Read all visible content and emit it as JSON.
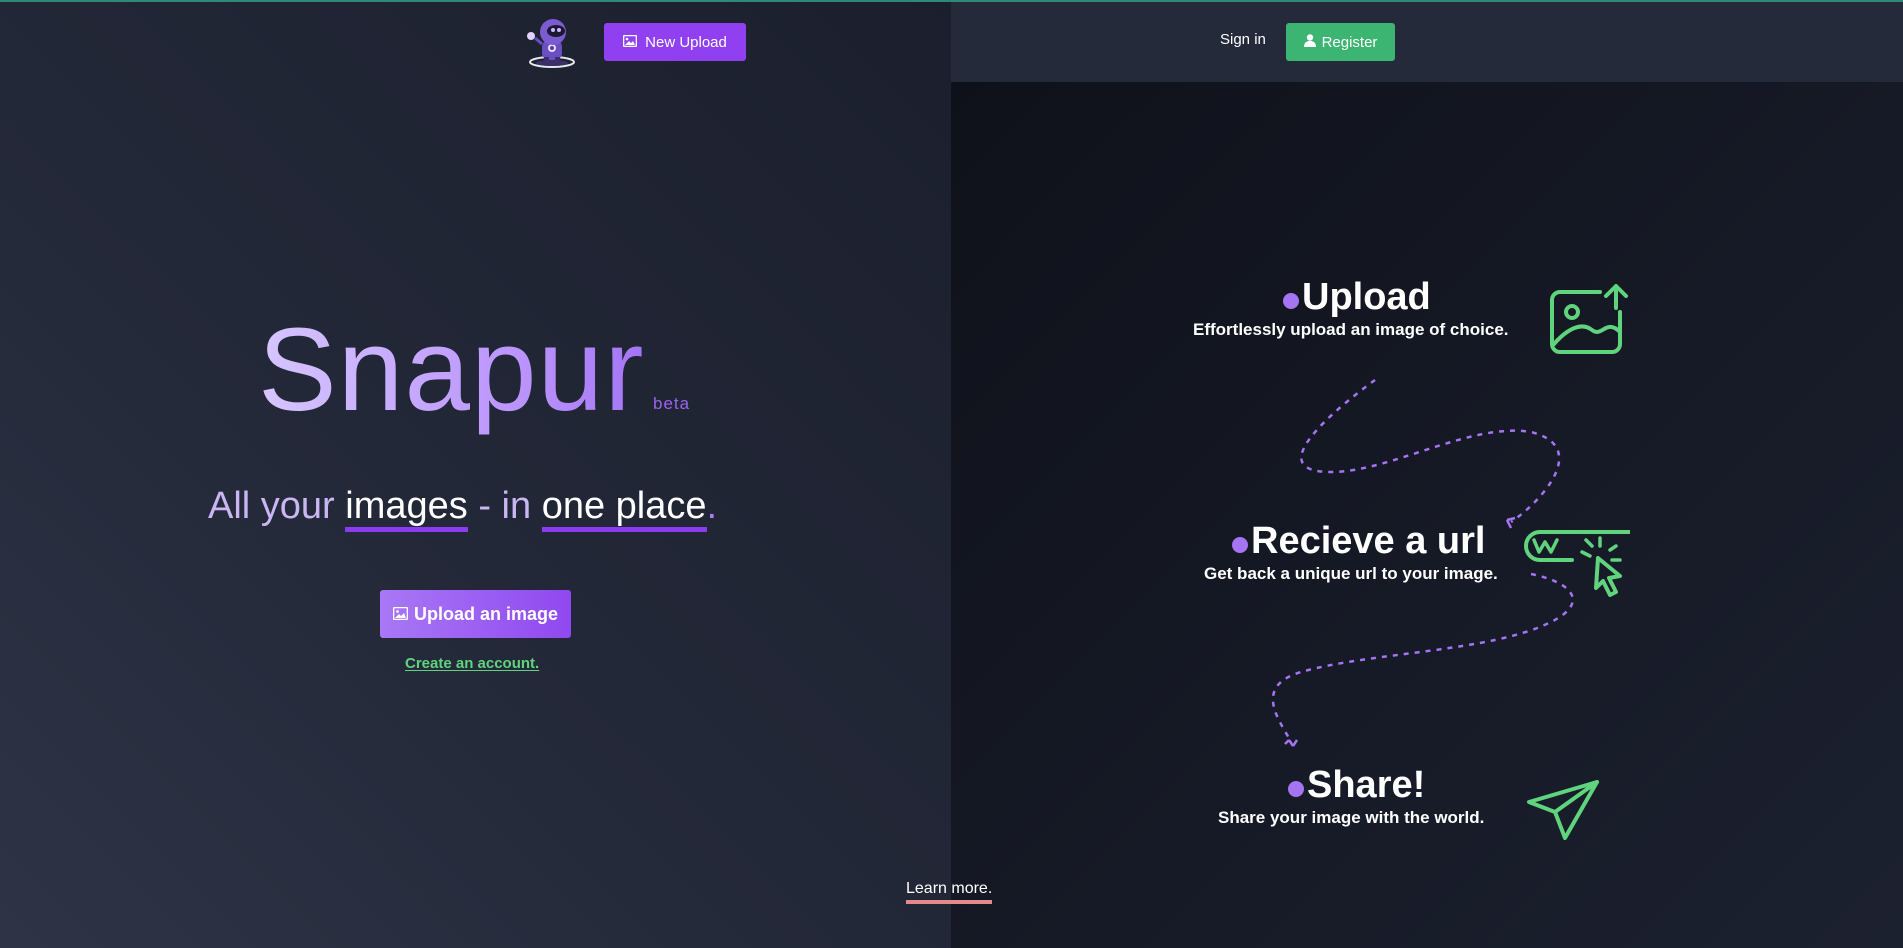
{
  "nav": {
    "new_upload_label": "New Upload",
    "sign_in_label": "Sign in",
    "register_label": "Register"
  },
  "hero": {
    "brand": "Snapur",
    "badge": "beta",
    "tagline": {
      "part1": "All your ",
      "highlight1": "images",
      "part2": " - in ",
      "highlight2": "one place",
      "end": "."
    },
    "upload_button_label": "Upload an image",
    "create_account_label": "Create an account."
  },
  "steps": [
    {
      "title": "Upload",
      "description": "Effortlessly upload an image of choice.",
      "icon": "image-upload-icon"
    },
    {
      "title": "Recieve a url",
      "description": "Get back a unique url to your image.",
      "icon": "url-click-icon"
    },
    {
      "title": "Share!",
      "description": "Share your image with the world.",
      "icon": "paper-plane-icon"
    }
  ],
  "footer": {
    "learn_more_label": "Learn more."
  },
  "colors": {
    "accent_purple": "#9040f0",
    "accent_green": "#3cb472",
    "icon_green": "#5fd47d",
    "bullet_purple": "#a474f2"
  }
}
